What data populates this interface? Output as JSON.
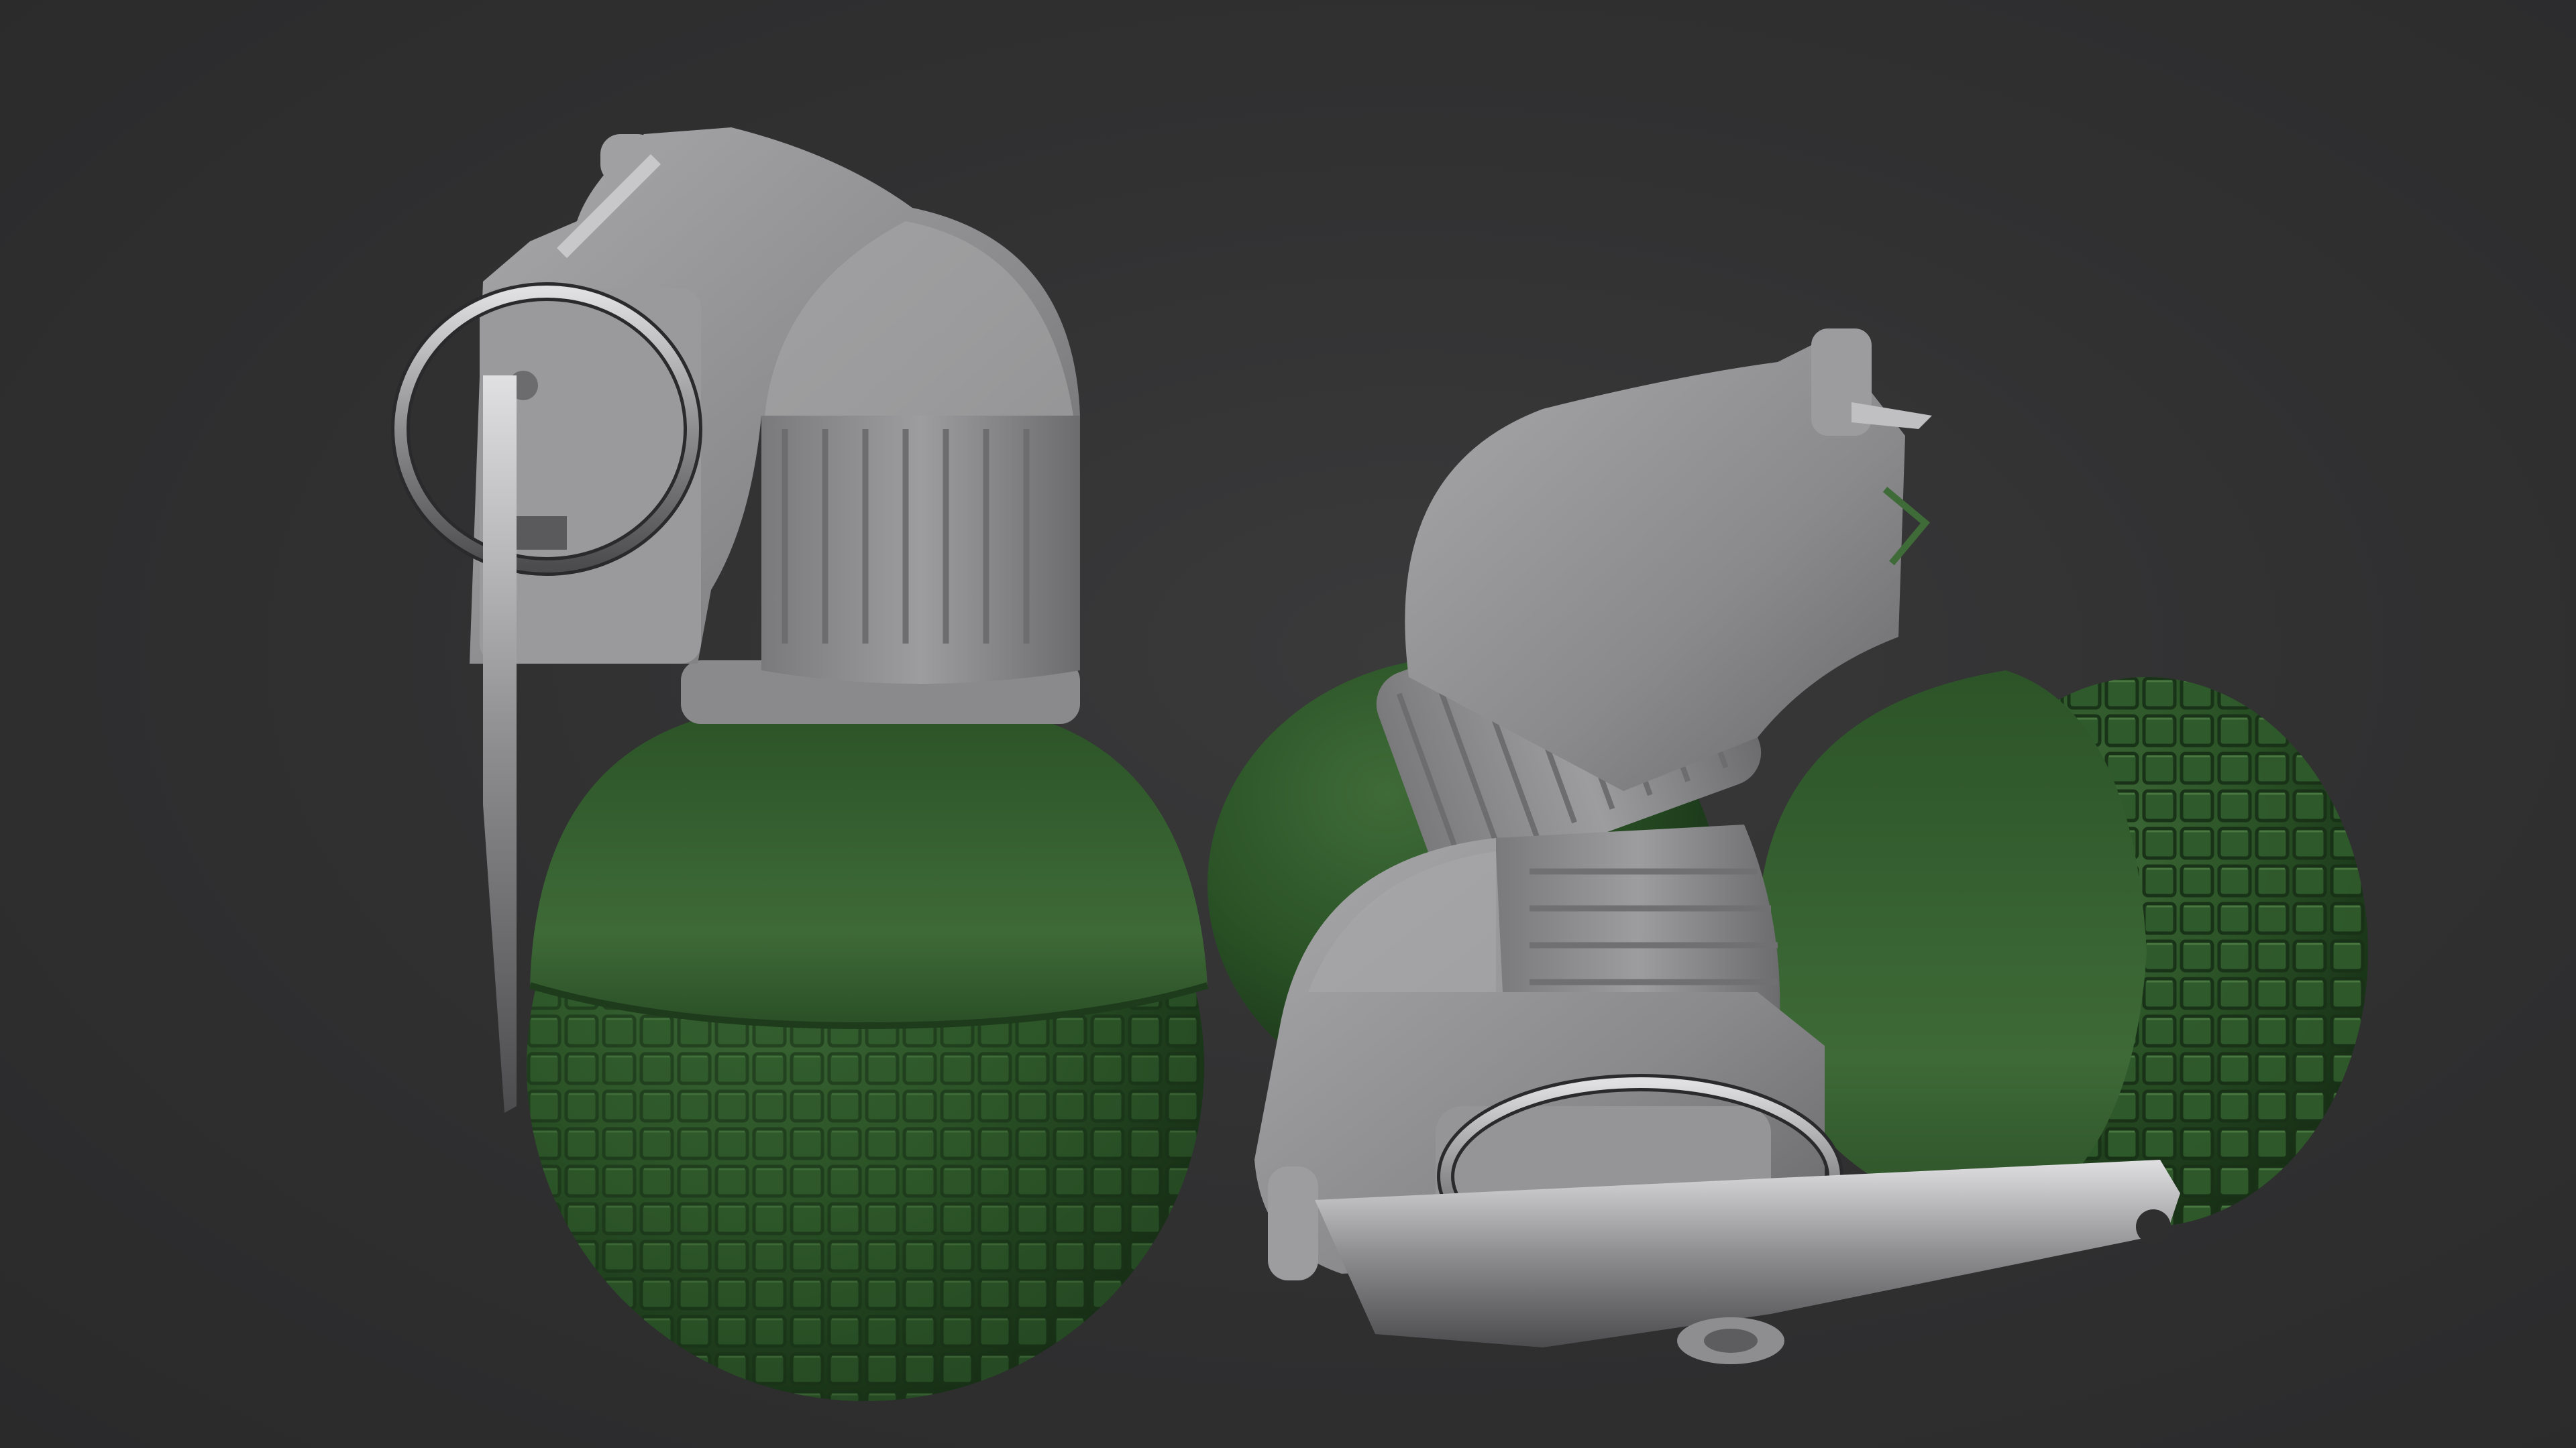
{
  "scene": {
    "background_color": "#313132",
    "objects": [
      {
        "name": "grenade-upright",
        "body_color": "#244a22",
        "fuze_color": "#8c8c8e"
      },
      {
        "name": "grenade-rear-lying",
        "body_color": "#244a22",
        "fuze_color": "#8c8c8e"
      },
      {
        "name": "grenade-front-lying",
        "body_color": "#244a22",
        "fuze_color": "#8c8c8e"
      }
    ],
    "metal_color": "#b8b8ba"
  }
}
